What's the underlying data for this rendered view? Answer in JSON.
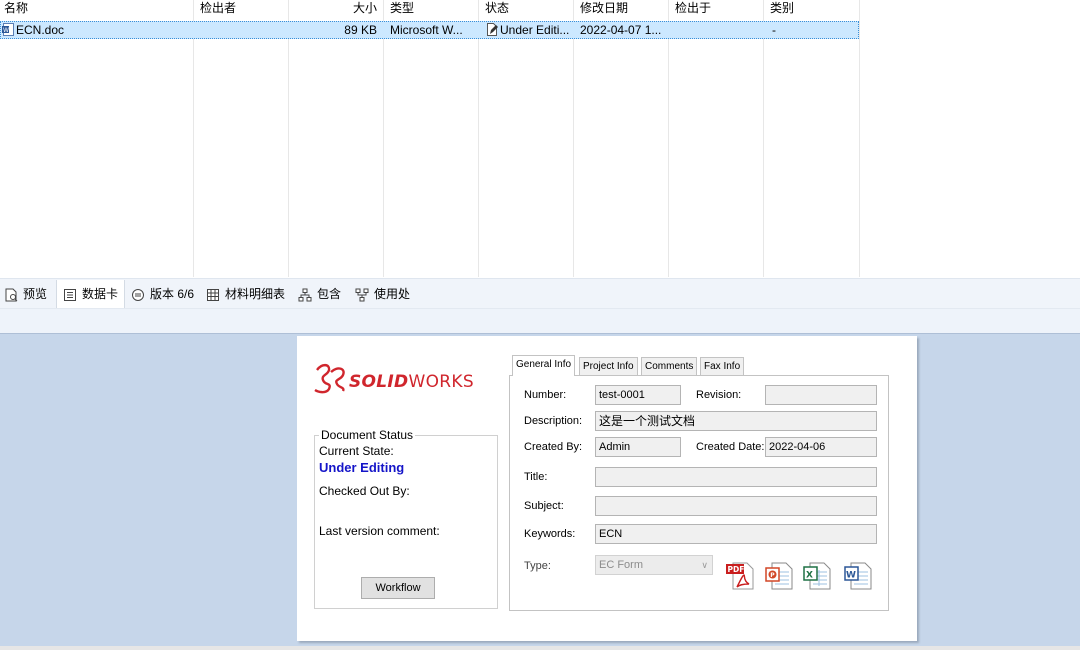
{
  "file_list": {
    "columns": [
      "名称",
      "检出者",
      "大小",
      "类型",
      "状态",
      "修改日期",
      "检出于",
      "类别"
    ],
    "rows": [
      {
        "name": "ECN.doc",
        "checked_out_by": "",
        "size": "89 KB",
        "type": "Microsoft W...",
        "state": "Under Editi...",
        "modified": "2022-04-07 1...",
        "checked_out_in": "",
        "category": "-"
      }
    ]
  },
  "tabs": [
    {
      "label": "预览",
      "icon": "preview-icon"
    },
    {
      "label": "数据卡",
      "icon": "datacard-icon",
      "active": true
    },
    {
      "label": "版本 6/6",
      "icon": "version-icon"
    },
    {
      "label": "材料明细表",
      "icon": "bom-icon"
    },
    {
      "label": "包含",
      "icon": "contains-icon"
    },
    {
      "label": "使用处",
      "icon": "where-used-icon"
    }
  ],
  "card": {
    "logo": {
      "prefix": "SOLID",
      "suffix": "WORKS"
    },
    "document_status": {
      "legend": "Document Status",
      "current_state_label": "Current State:",
      "current_state_value": "Under Editing",
      "checked_out_by_label": "Checked Out By:",
      "last_version_comment_label": "Last version comment:",
      "workflow_button": "Workflow"
    },
    "inner_tabs": [
      "General Info",
      "Project Info",
      "Comments",
      "Fax Info"
    ],
    "fields": {
      "number_label": "Number:",
      "number_value": "test-0001",
      "revision_label": "Revision:",
      "revision_value": "",
      "description_label": "Description:",
      "description_value": "这是一个测试文档",
      "created_by_label": "Created By:",
      "created_by_value": "Admin",
      "created_date_label": "Created Date:",
      "created_date_value": "2022-04-06",
      "title_label": "Title:",
      "title_value": "",
      "subject_label": "Subject:",
      "subject_value": "",
      "keywords_label": "Keywords:",
      "keywords_value": "ECN",
      "type_label": "Type:",
      "type_value": "EC Form"
    },
    "doc_icons": [
      "pdf-icon",
      "powerpoint-icon",
      "excel-icon",
      "word-icon"
    ]
  },
  "colors": {
    "selection": "#cce8ff",
    "state_text": "#1414c8",
    "logo_red": "#d0262d",
    "card_background": "#c6d6ea"
  }
}
